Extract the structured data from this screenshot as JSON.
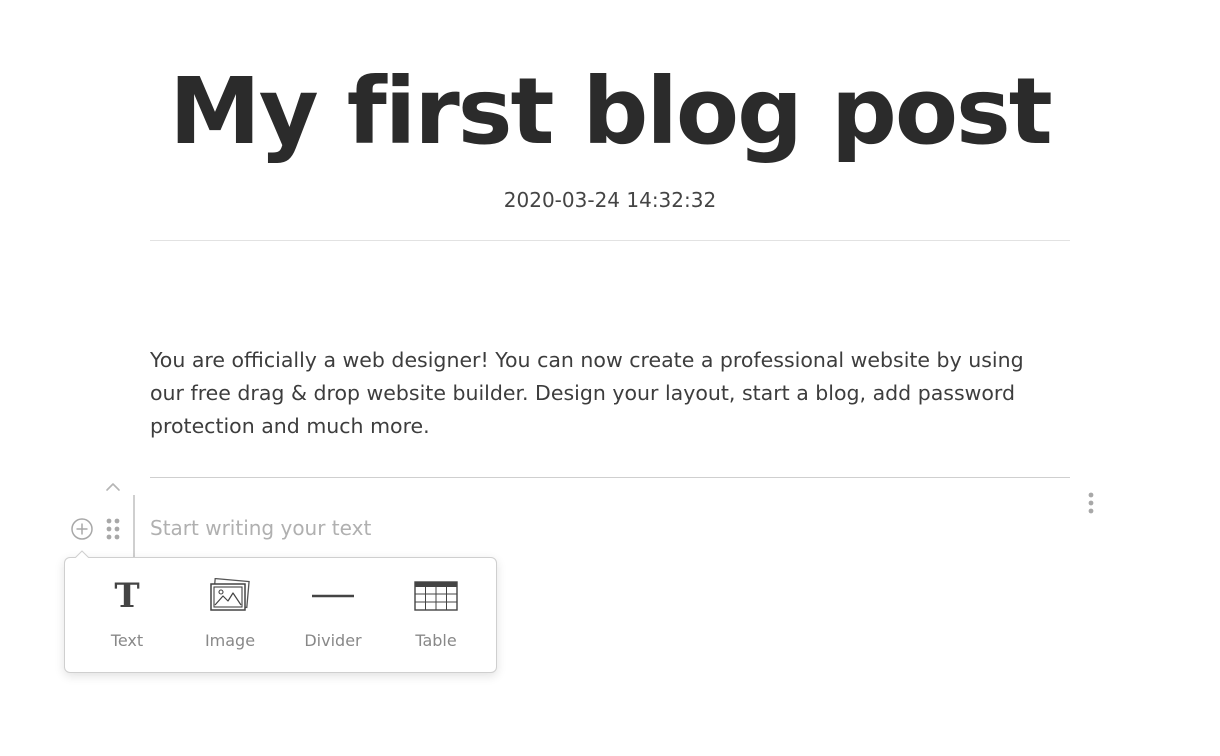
{
  "post": {
    "title": "My first blog post",
    "date": "2020-03-24 14:32:32",
    "body": "You are officially a web designer! You can now create a professional website by using our free drag & drop website builder. Design your layout, start a blog, add password protection and much more."
  },
  "editor": {
    "new_block_placeholder": "Start writing your text",
    "insert_menu": {
      "items": [
        {
          "label": "Text",
          "icon": "text-icon"
        },
        {
          "label": "Image",
          "icon": "image-icon"
        },
        {
          "label": "Divider",
          "icon": "divider-icon"
        },
        {
          "label": "Table",
          "icon": "table-icon"
        }
      ]
    }
  },
  "colors": {
    "title": "#2b2b2b",
    "placeholder": "#b0b0b0",
    "menu_label": "#888888",
    "divider": "#cfcfcf"
  }
}
